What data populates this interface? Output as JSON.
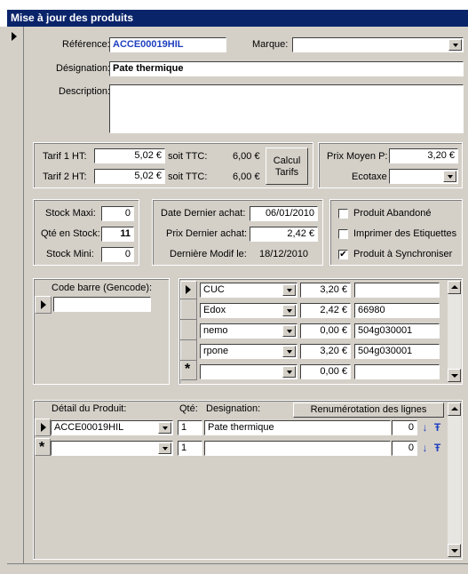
{
  "window": {
    "title": "Mise à jour des produits"
  },
  "product": {
    "reference_label": "Référence:",
    "reference_value": "ACCE00019HIL",
    "brand_label": "Marque:",
    "brand_value": "",
    "designation_label": "Désignation:",
    "designation_value": "Pate thermique",
    "description_label": "Description:",
    "description_value": ""
  },
  "pricing": {
    "tarif1_label": "Tarif 1 HT:",
    "tarif1_value": "5,02 €",
    "soit1_label": "soit TTC:",
    "ttc1_value": "6,00 €",
    "tarif2_label": "Tarif 2 HT:",
    "tarif2_value": "5,02 €",
    "soit2_label": "soit TTC:",
    "ttc2_value": "6,00 €",
    "calc_button_line1": "Calcul",
    "calc_button_line2": "Tarifs",
    "prix_moyen_label": "Prix Moyen P:",
    "prix_moyen_value": "3,20 €",
    "ecotaxe_label": "Ecotaxe",
    "ecotaxe_value": ""
  },
  "stock": {
    "maxi_label": "Stock Maxi:",
    "maxi_value": "0",
    "qte_label": "Qté en Stock:",
    "qte_value": "11",
    "mini_label": "Stock Mini:",
    "mini_value": "0"
  },
  "purchase": {
    "date_label": "Date Dernier achat:",
    "date_value": "06/01/2010",
    "prix_label": "Prix Dernier achat:",
    "prix_value": "2,42 €",
    "modif_label": "Dernière Modif le:",
    "modif_value": "18/12/2010"
  },
  "flags": {
    "abandonne_label": "Produit Abandoné",
    "abandonne_checked": false,
    "etiquettes_label": "Imprimer des Etiquettes",
    "etiquettes_checked": false,
    "synchroniser_label": "Produit à Synchroniser",
    "synchroniser_checked": true
  },
  "barcode": {
    "label": "Code barre (Gencode):",
    "value": ""
  },
  "suppliers": [
    {
      "name": "CUC",
      "price": "3,20 €",
      "ref": ""
    },
    {
      "name": "Edox",
      "price": "2,42 €",
      "ref": "66980"
    },
    {
      "name": "nemo",
      "price": "0,00 €",
      "ref": "504g030001"
    },
    {
      "name": "rpone",
      "price": "3,20 €",
      "ref": "504g030001"
    },
    {
      "name": "",
      "price": "0,00 €",
      "ref": ""
    }
  ],
  "detail": {
    "header_detail": "Détail du Produit:",
    "header_qte": "Qté:",
    "header_designation": "Designation:",
    "renumber_button": "Renumérotation des lignes",
    "rows": [
      {
        "ref": "ACCE00019HIL",
        "qte": "1",
        "designation": "Pate thermique",
        "order": "0"
      },
      {
        "ref": "",
        "qte": "1",
        "designation": "",
        "order": "0"
      }
    ]
  },
  "icons": {
    "record_pointer": "arrow-right-icon",
    "new_record": "asterisk-icon",
    "move_down": "arrow-down-icon",
    "move_up": "pin-icon"
  }
}
